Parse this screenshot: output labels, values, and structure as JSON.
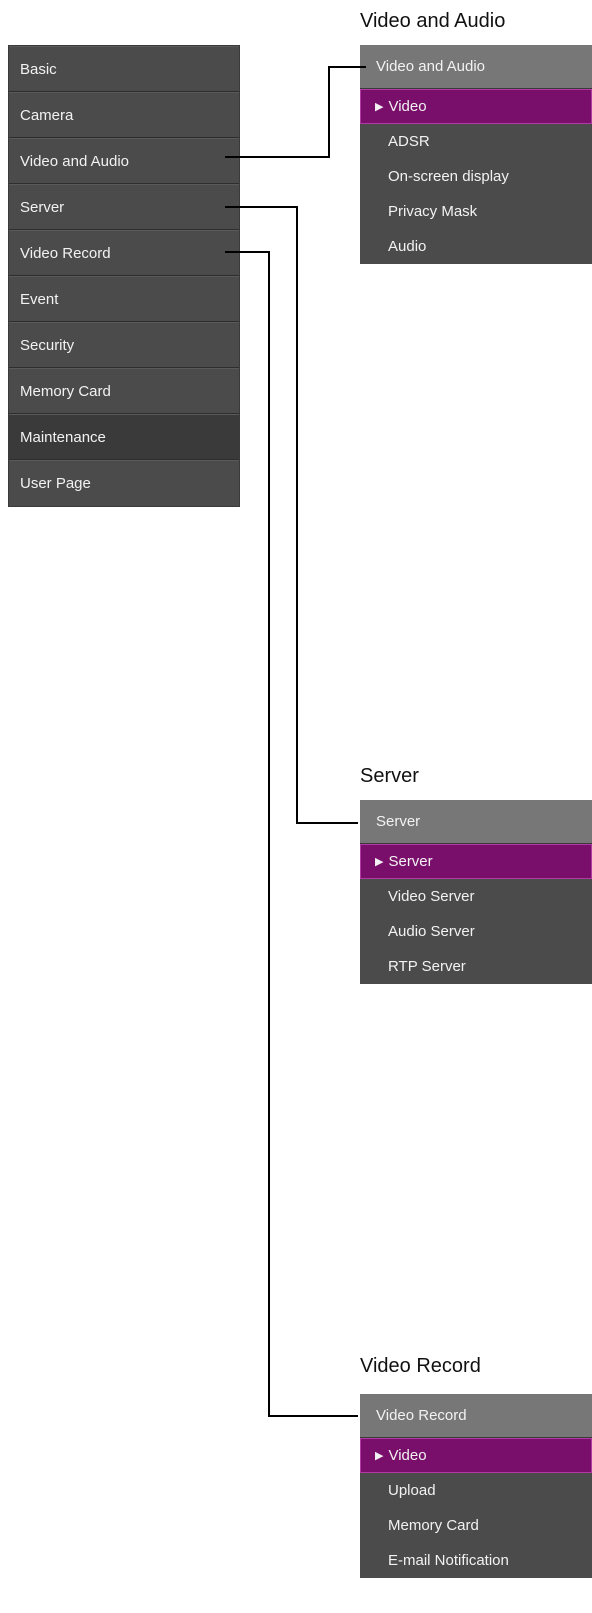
{
  "main_menu": {
    "items": [
      {
        "label": "Basic"
      },
      {
        "label": "Camera"
      },
      {
        "label": "Video and Audio"
      },
      {
        "label": "Server"
      },
      {
        "label": "Video Record"
      },
      {
        "label": "Event"
      },
      {
        "label": "Security"
      },
      {
        "label": "Memory Card"
      },
      {
        "label": "Maintenance"
      },
      {
        "label": "User Page"
      }
    ]
  },
  "panels": {
    "video_audio": {
      "title": "Video and Audio",
      "header": "Video and Audio",
      "items": [
        {
          "label": "Video",
          "active": true
        },
        {
          "label": "ADSR"
        },
        {
          "label": "On-screen display"
        },
        {
          "label": "Privacy Mask"
        },
        {
          "label": "Audio"
        }
      ]
    },
    "server": {
      "title": "Server",
      "header": "Server",
      "items": [
        {
          "label": "Server",
          "active": true
        },
        {
          "label": "Video Server"
        },
        {
          "label": "Audio Server"
        },
        {
          "label": "RTP Server"
        }
      ]
    },
    "video_record": {
      "title": "Video Record",
      "header": "Video Record",
      "items": [
        {
          "label": "Video",
          "active": true
        },
        {
          "label": "Upload"
        },
        {
          "label": "Memory Card"
        },
        {
          "label": "E-mail Notification"
        }
      ]
    }
  },
  "active_marker": "▶"
}
